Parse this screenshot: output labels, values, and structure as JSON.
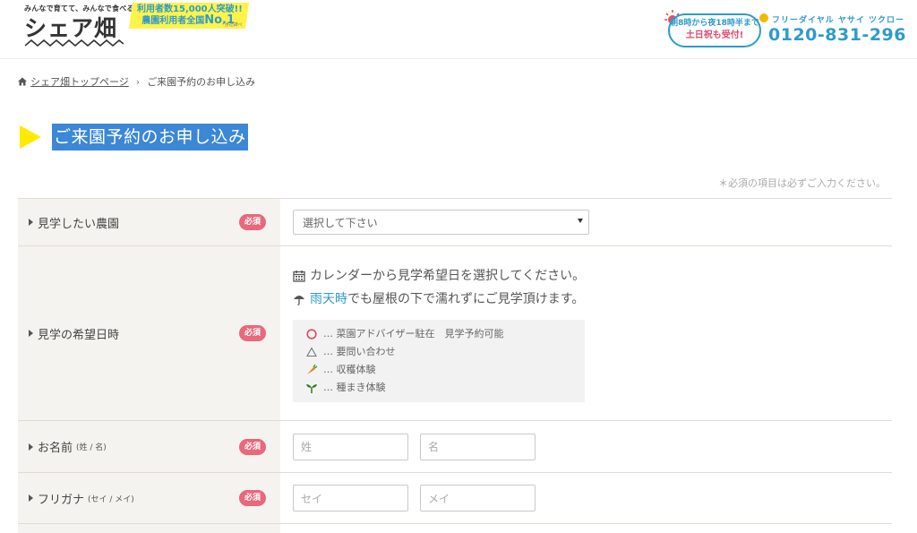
{
  "header": {
    "logo_tagline": "みんなで育てて、みんなで食べる。",
    "logo_name": "シェア畑",
    "badge_line1": "利用者数15,000人突破!!",
    "badge_line2_prefix": "農園利用者全国",
    "badge_line2_rank": "No.1",
    "badge_note": "*当社調べ",
    "hours_line": "朝8時から夜18時半まで",
    "weekend_line": "土日祝も受付!",
    "free_dial_label": "フリーダイヤル ヤサイ ツクロー",
    "phone_number": "0120-831-296"
  },
  "breadcrumb": {
    "home_label": "シェア畑トップページ",
    "separator": "›",
    "current": "ご来園予約のお申し込み"
  },
  "page_title": "ご来園予約のお申し込み",
  "required_note": "＊必須の項目は必ずご入力ください。",
  "required_badge": "必須",
  "form": {
    "farm": {
      "label": "見学したい農園",
      "select_value": "選択して下さい"
    },
    "date": {
      "label": "見学の希望日時",
      "line1": "カレンダーから見学希望日を選択してください。",
      "line2_prefix": "",
      "line2_highlight": "雨天時",
      "line2_suffix": "でも屋根の下で濡れずにご見学頂けます。",
      "legend": [
        {
          "icon": "circle-icon",
          "text": "… 菜園アドバイザー駐在　見学予約可能"
        },
        {
          "icon": "triangle-icon",
          "text": "… 要問い合わせ"
        },
        {
          "icon": "carrot-icon",
          "text": "… 収穫体験"
        },
        {
          "icon": "sprout-icon",
          "text": "… 種まき体験"
        }
      ]
    },
    "name": {
      "label": "お名前",
      "sub": "(姓 / 名)",
      "placeholder_last": "姓",
      "placeholder_first": "名"
    },
    "kana": {
      "label": "フリガナ",
      "sub": "(セイ / メイ)",
      "placeholder_last": "セイ",
      "placeholder_first": "メイ"
    }
  },
  "colors": {
    "accent_blue": "#2e9bcc",
    "title_bg": "#3c87d6",
    "required_pink": "#e9687b",
    "arrow_yellow": "#ffea00"
  }
}
